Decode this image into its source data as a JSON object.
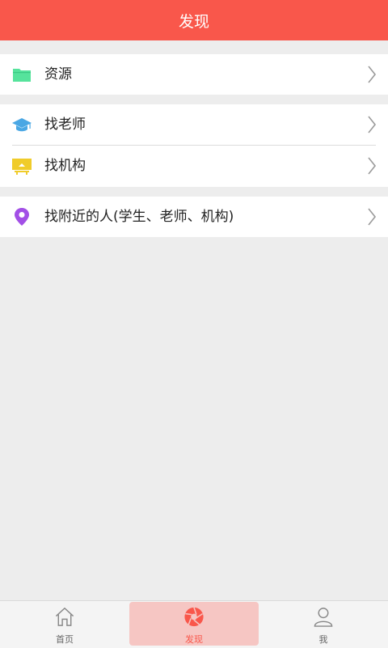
{
  "header": {
    "title": "发现"
  },
  "groups": [
    {
      "items": [
        {
          "label": "资源"
        }
      ]
    },
    {
      "items": [
        {
          "label": "找老师"
        },
        {
          "label": "找机构"
        }
      ]
    },
    {
      "items": [
        {
          "label": "找附近的人(学生、老师、机构)"
        }
      ]
    }
  ],
  "tabbar": {
    "tabs": [
      {
        "label": "首页",
        "icon": "home-icon"
      },
      {
        "label": "发现",
        "icon": "aperture-icon",
        "active": true
      },
      {
        "label": "我",
        "icon": "person-icon"
      }
    ]
  },
  "colors": {
    "accent": "#f9574b",
    "folder": "#56e39c",
    "cap": "#4aa7e4",
    "institution": "#f0cc2a",
    "location": "#a24fe6"
  }
}
